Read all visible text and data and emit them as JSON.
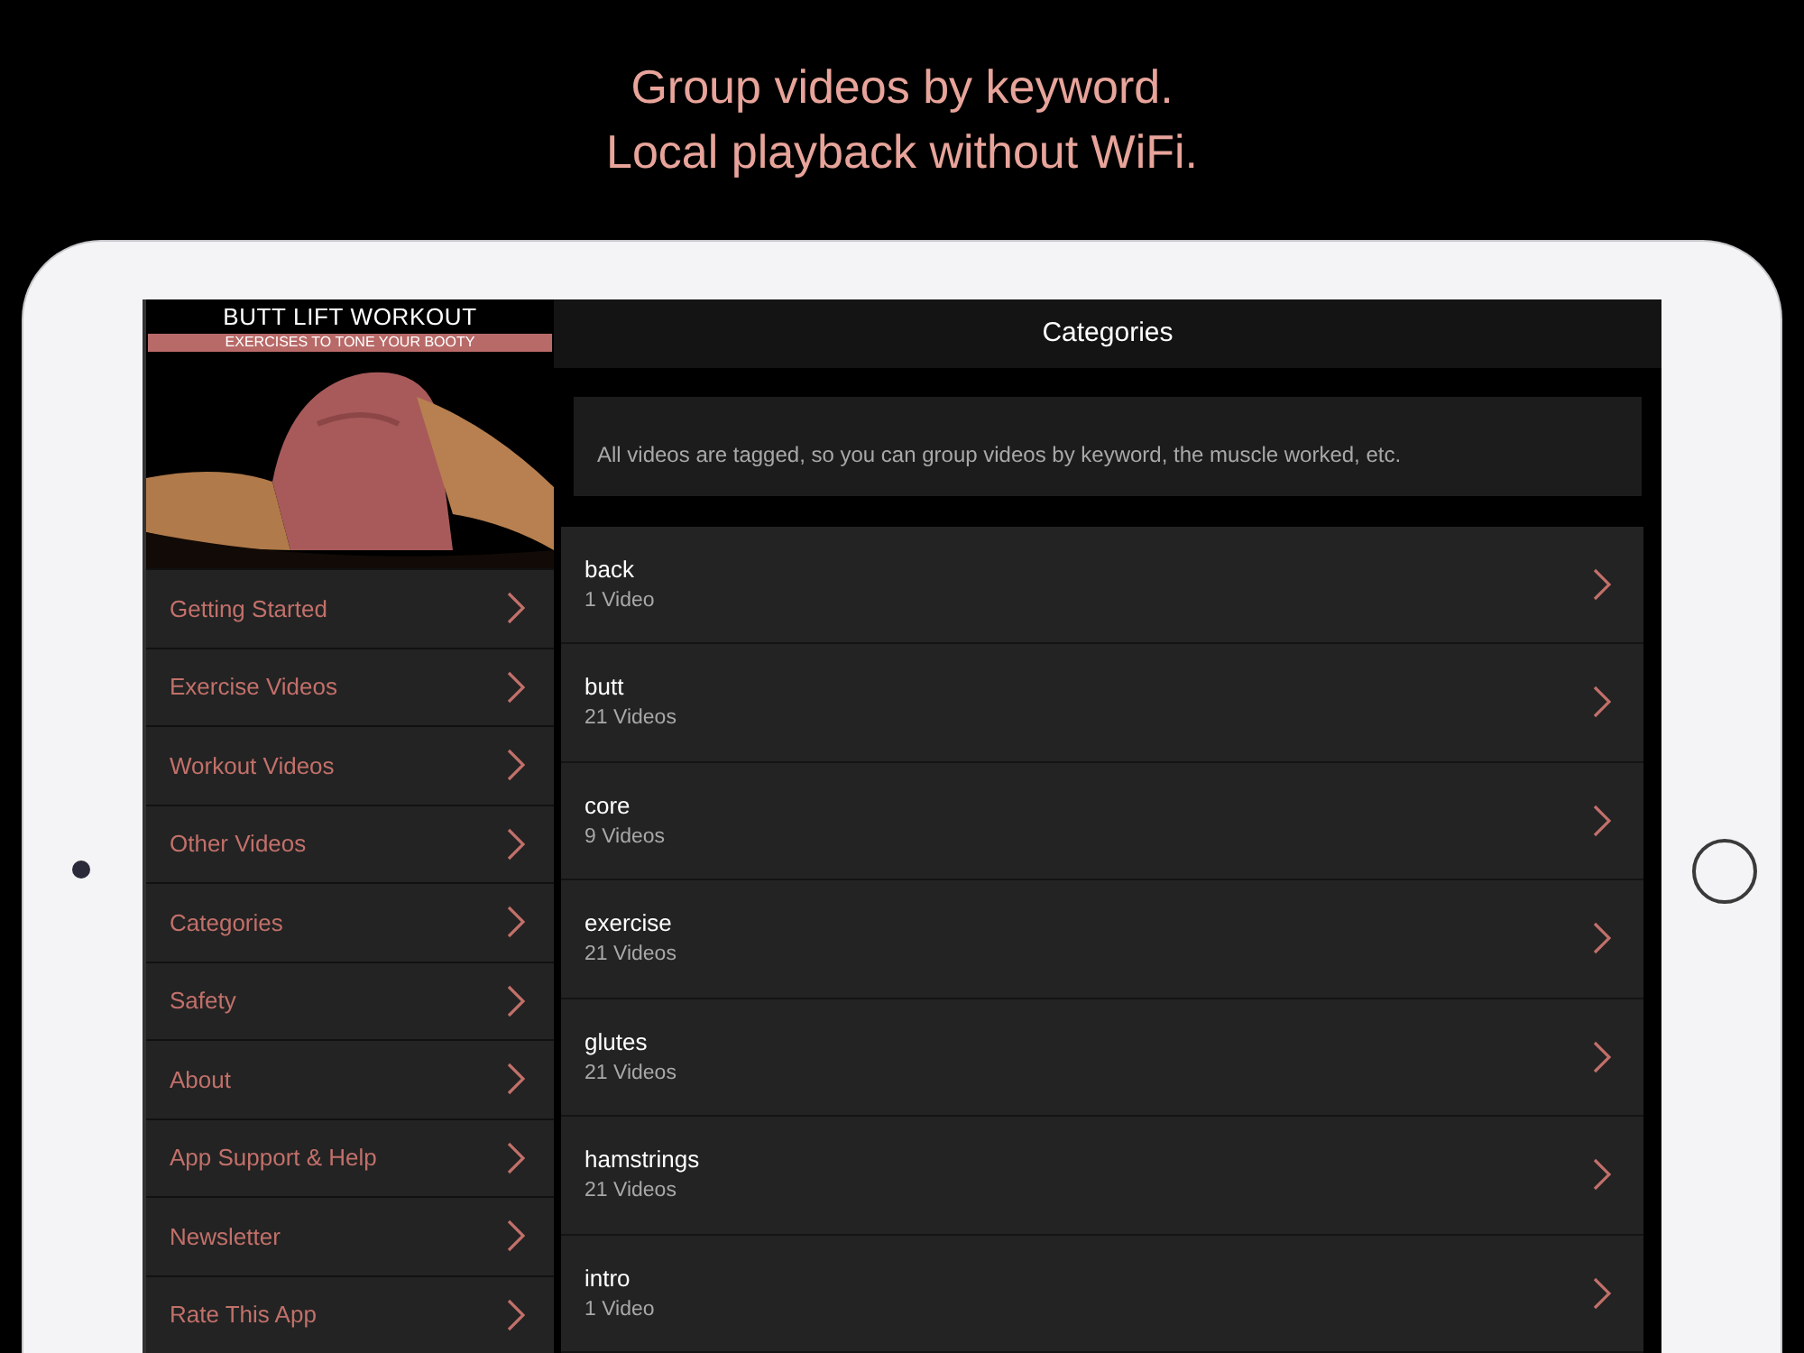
{
  "caption": [
    "Group videos by keyword.",
    "Local playback without WiFi."
  ],
  "banner": {
    "title": "BUTT LIFT WORKOUT",
    "subtitle": "EXERCISES TO TONE YOUR BOOTY",
    "kind": "picture"
  },
  "sidebar": {
    "items": [
      {
        "label": "Getting Started"
      },
      {
        "label": "Exercise Videos"
      },
      {
        "label": "Workout Videos"
      },
      {
        "label": "Other Videos"
      },
      {
        "label": "Categories"
      },
      {
        "label": "Safety"
      },
      {
        "label": "About"
      },
      {
        "label": "App Support & Help"
      },
      {
        "label": "Newsletter"
      },
      {
        "label": "Rate This App"
      }
    ]
  },
  "header": {
    "title": "Categories"
  },
  "info": "All videos are tagged, so you can group videos by keyword, the muscle worked, etc.",
  "categories": [
    {
      "name": "back",
      "count": "1 Video"
    },
    {
      "name": "butt",
      "count": "21 Videos"
    },
    {
      "name": "core",
      "count": "9 Videos"
    },
    {
      "name": "exercise",
      "count": "21 Videos"
    },
    {
      "name": "glutes",
      "count": "21 Videos"
    },
    {
      "name": "hamstrings",
      "count": "21 Videos"
    },
    {
      "name": "intro",
      "count": "1 Video"
    }
  ]
}
